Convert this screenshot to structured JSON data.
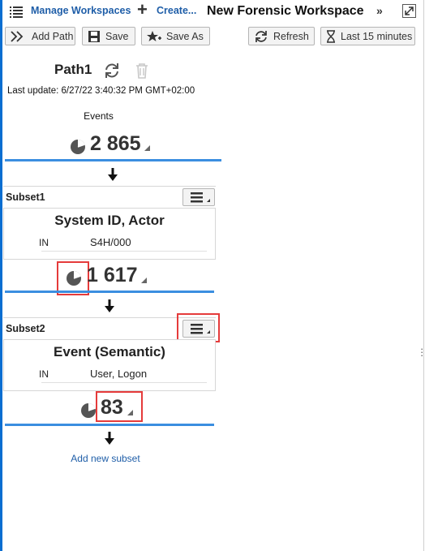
{
  "header": {
    "manage_label": "Manage Workspaces",
    "create_label": "Create...",
    "title": "New Forensic Workspace",
    "more_label": "»"
  },
  "toolbar": {
    "add_path": "Add Path",
    "save": "Save",
    "save_as": "Save As",
    "refresh": "Refresh",
    "timeframe": "Last 15 minutes"
  },
  "path": {
    "title": "Path1",
    "last_update": "Last update: 6/27/22 3:40:32 PM GMT+02:00",
    "events_label": "Events",
    "events_count": "2 865"
  },
  "subsets": [
    {
      "name": "Subset1",
      "filter_title": "System ID, Actor",
      "operator": "IN",
      "value": "S4H/000",
      "count": "1 617"
    },
    {
      "name": "Subset2",
      "filter_title": "Event (Semantic)",
      "operator": "IN",
      "value": "User, Logon",
      "count": "83"
    }
  ],
  "add_subset_label": "Add new subset",
  "colors": {
    "accent_blue": "#3b8ee0",
    "link_blue": "#1f5ea8",
    "highlight_red": "#e53b3b"
  }
}
